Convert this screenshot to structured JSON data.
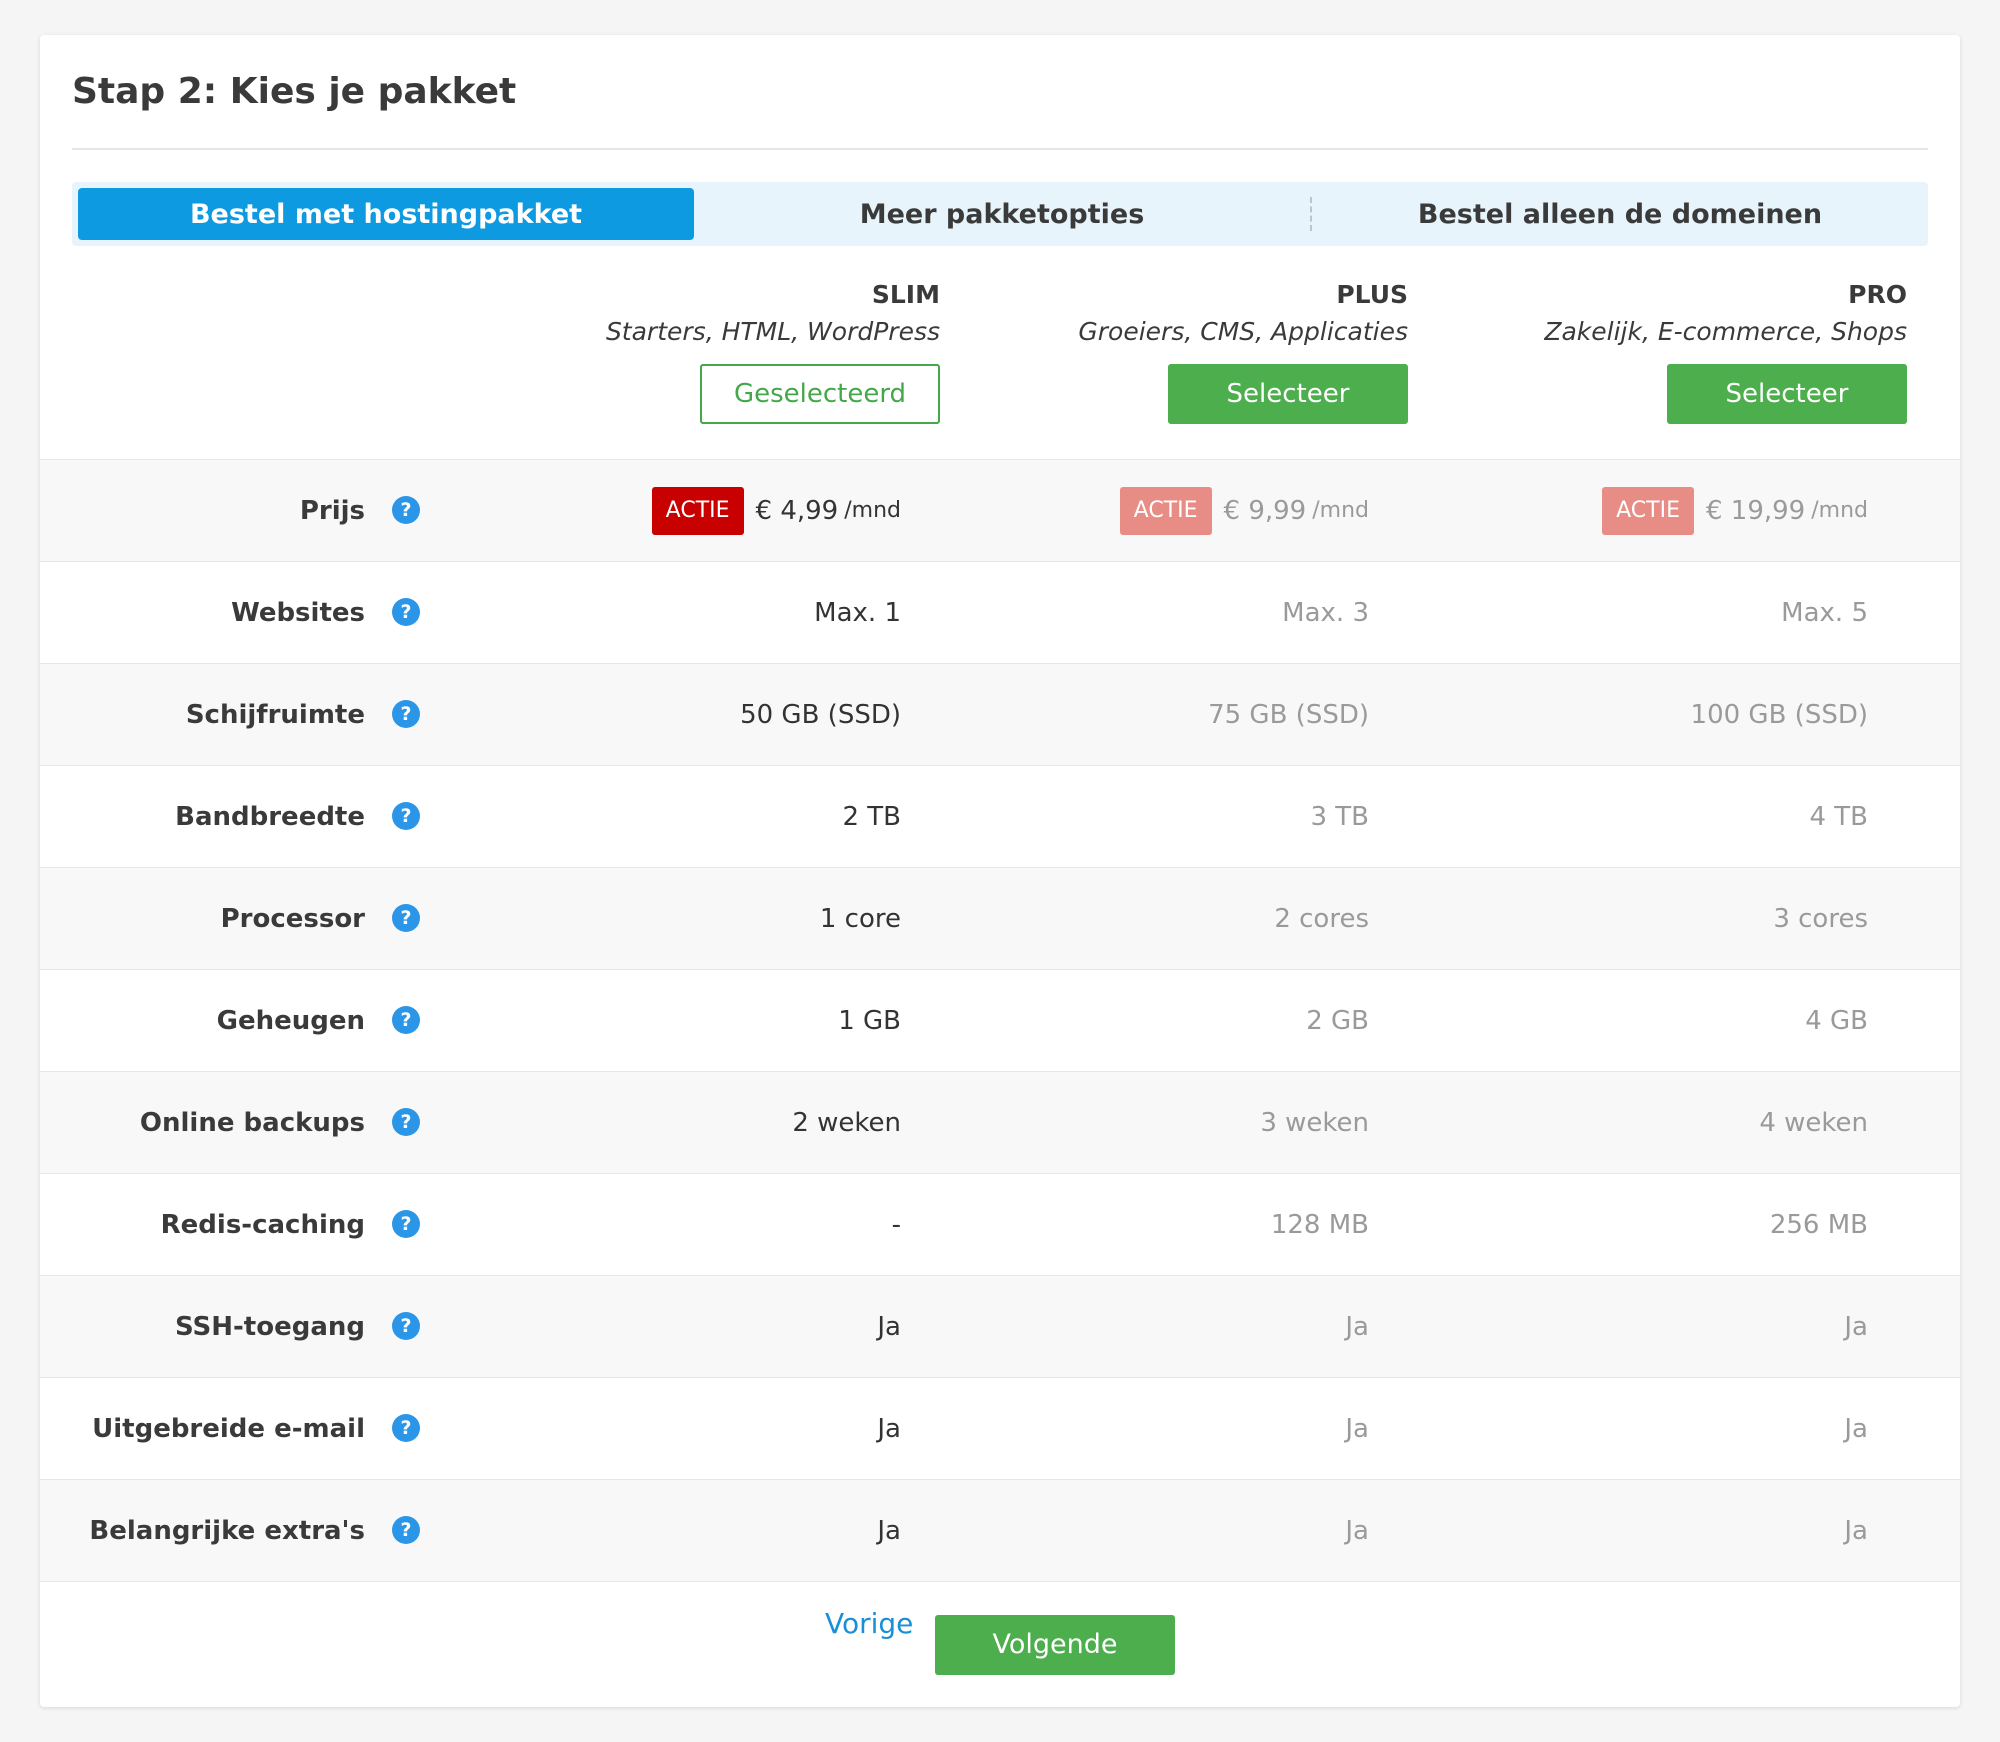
{
  "title": "Stap 2: Kies je pakket",
  "tabs": [
    {
      "label": "Bestel met hostingpakket",
      "active": true
    },
    {
      "label": "Meer pakketopties",
      "active": false
    },
    {
      "label": "Bestel alleen de domeinen",
      "active": false
    }
  ],
  "plans": [
    {
      "name": "SLIM",
      "desc": "Starters, HTML, WordPress",
      "button": "Geselecteerd",
      "selected": true
    },
    {
      "name": "PLUS",
      "desc": "Groeiers, CMS, Applicaties",
      "button": "Selecteer",
      "selected": false
    },
    {
      "name": "PRO",
      "desc": "Zakelijk, E-commerce, Shops",
      "button": "Selecteer",
      "selected": false
    }
  ],
  "price_row": {
    "label": "Prijs",
    "badge": "ACTIE",
    "per": "/mnd",
    "values": [
      "€ 4,99",
      "€ 9,99",
      "€ 19,99"
    ]
  },
  "features": [
    {
      "label": "Websites",
      "values": [
        "Max. 1",
        "Max. 3",
        "Max. 5"
      ]
    },
    {
      "label": "Schijfruimte",
      "values": [
        "50 GB (SSD)",
        "75 GB (SSD)",
        "100 GB (SSD)"
      ]
    },
    {
      "label": "Bandbreedte",
      "values": [
        "2 TB",
        "3 TB",
        "4 TB"
      ]
    },
    {
      "label": "Processor",
      "values": [
        "1 core",
        "2 cores",
        "3 cores"
      ]
    },
    {
      "label": "Geheugen",
      "values": [
        "1 GB",
        "2 GB",
        "4 GB"
      ]
    },
    {
      "label": "Online backups",
      "values": [
        "2 weken",
        "3 weken",
        "4 weken"
      ]
    },
    {
      "label": "Redis-caching",
      "values": [
        "-",
        "128 MB",
        "256 MB"
      ]
    },
    {
      "label": "SSH-toegang",
      "values": [
        "Ja",
        "Ja",
        "Ja"
      ]
    },
    {
      "label": "Uitgebreide e-mail",
      "values": [
        "Ja",
        "Ja",
        "Ja"
      ]
    },
    {
      "label": "Belangrijke extra's",
      "values": [
        "Ja",
        "Ja",
        "Ja"
      ]
    }
  ],
  "help_glyph": "?",
  "footer": {
    "prev": "Vorige",
    "next": "Volgende"
  },
  "colors": {
    "tab_active": "#0d9ae0",
    "tab_bg": "#e7f4fb",
    "green": "#4cae4c",
    "badge_strong": "#c80000",
    "badge_light": "#e88d86",
    "help_icon": "#2b96e8",
    "link": "#1a8fd6"
  }
}
